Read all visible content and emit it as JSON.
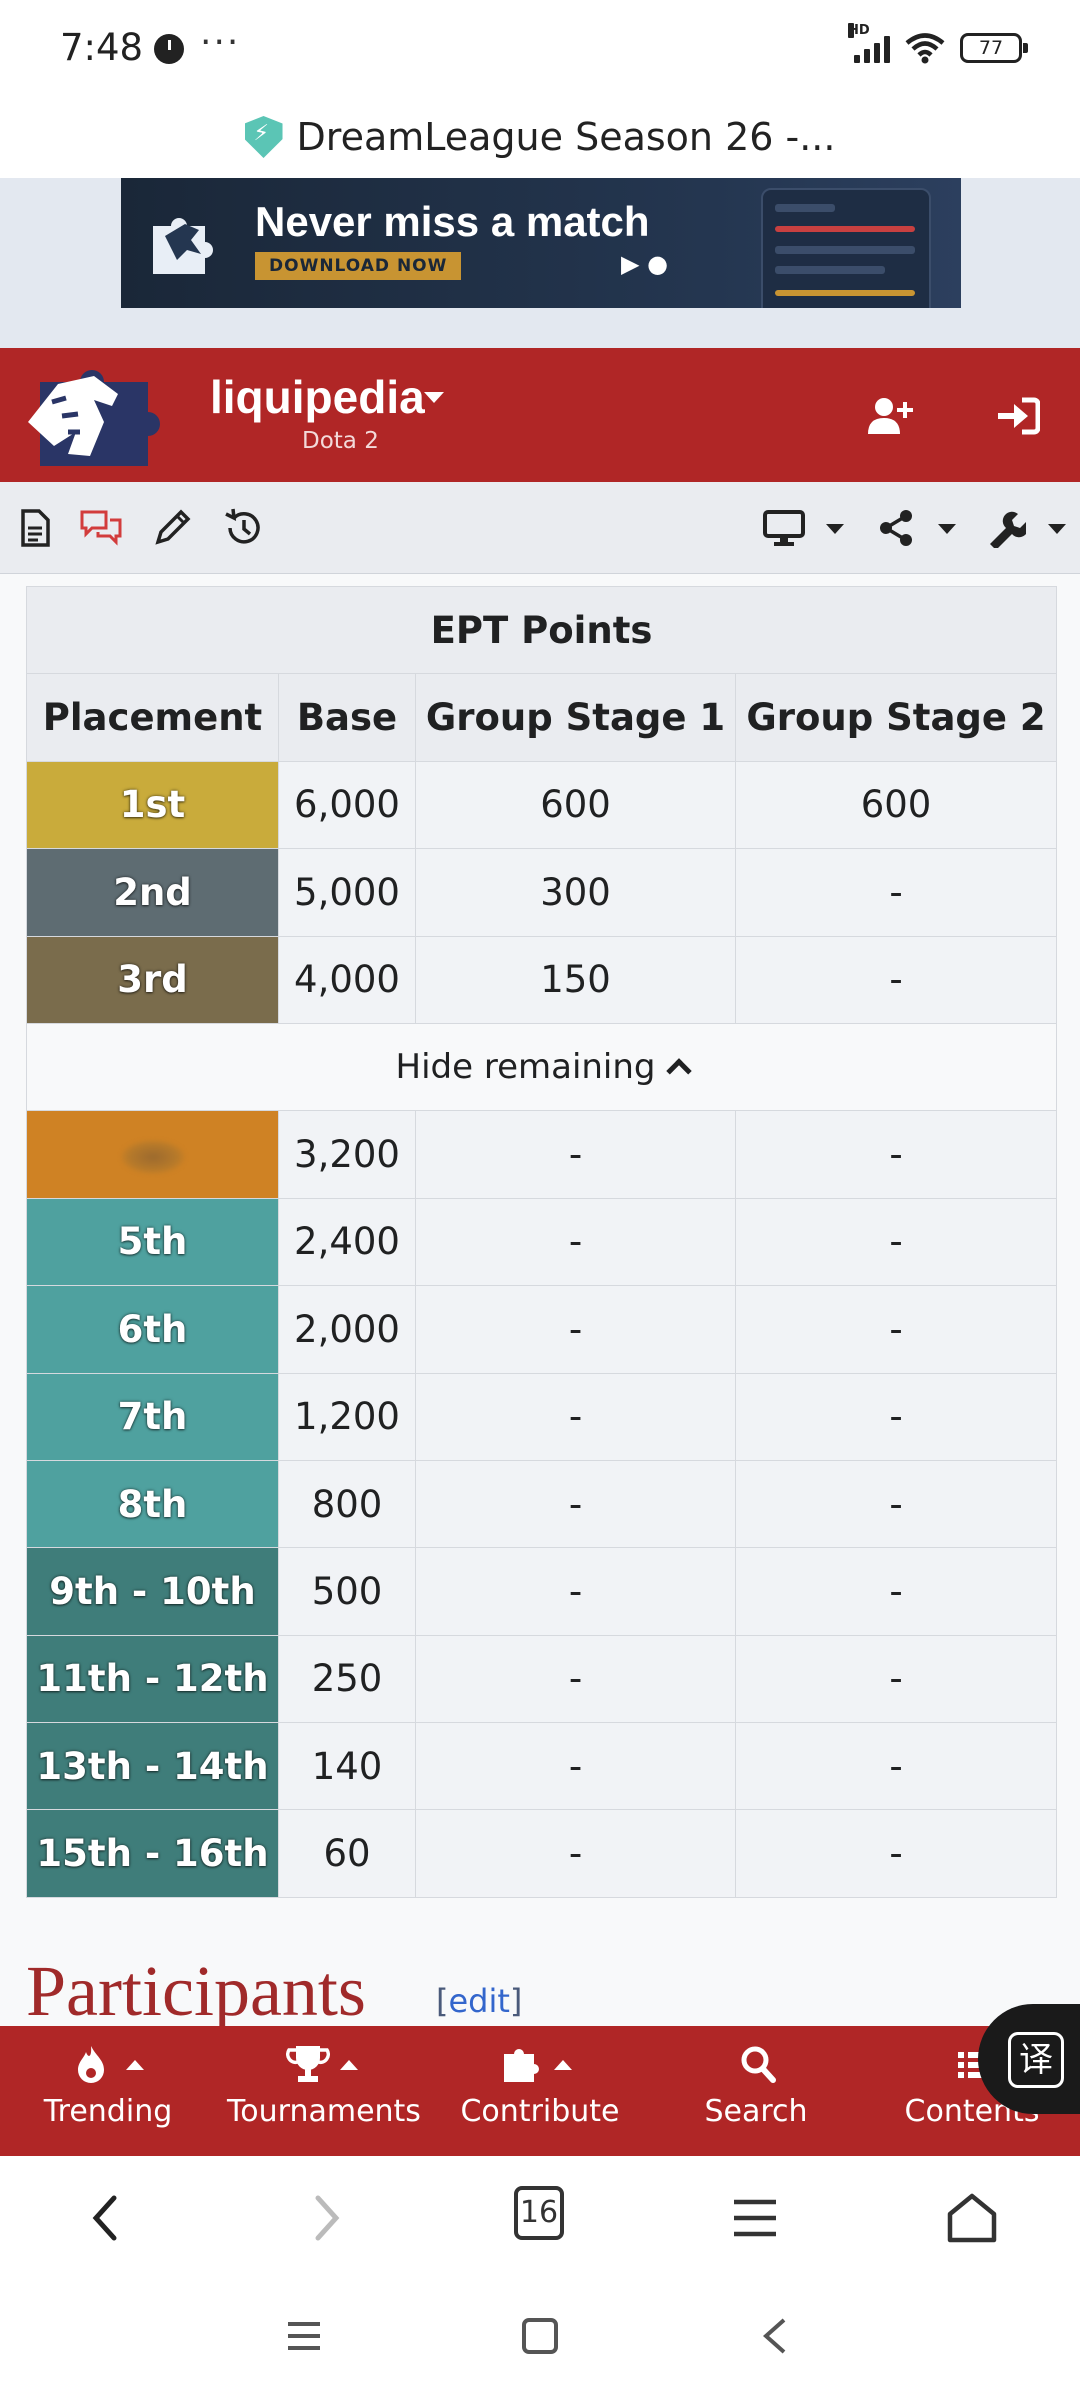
{
  "status_bar": {
    "time": "7:48",
    "more": "···",
    "network": "HD",
    "battery": "77"
  },
  "browser": {
    "page_title": "DreamLeague Season 26 -..."
  },
  "ad": {
    "headline": "Never miss a match",
    "cta": "DOWNLOAD NOW"
  },
  "site": {
    "name": "liquipedia",
    "wiki": "Dota 2"
  },
  "table": {
    "title": "EPT Points",
    "columns": [
      "Placement",
      "Base",
      "Group Stage 1",
      "Group Stage 2"
    ],
    "toggle_label": "Hide remaining",
    "rows": [
      {
        "placement": "1st",
        "base": "6,000",
        "gs1": "600",
        "gs2": "600",
        "color": "#c9ab3b"
      },
      {
        "placement": "2nd",
        "base": "5,000",
        "gs1": "300",
        "gs2": "-",
        "color": "#5e6c72"
      },
      {
        "placement": "3rd",
        "base": "4,000",
        "gs1": "150",
        "gs2": "-",
        "color": "#7a6c4c"
      },
      {
        "placement": "",
        "base": "3,200",
        "gs1": "-",
        "gs2": "-",
        "color": "#cf8224"
      },
      {
        "placement": "5th",
        "base": "2,400",
        "gs1": "-",
        "gs2": "-",
        "color": "#4fa19f"
      },
      {
        "placement": "6th",
        "base": "2,000",
        "gs1": "-",
        "gs2": "-",
        "color": "#4fa19f"
      },
      {
        "placement": "7th",
        "base": "1,200",
        "gs1": "-",
        "gs2": "-",
        "color": "#4fa19f"
      },
      {
        "placement": "8th",
        "base": "800",
        "gs1": "-",
        "gs2": "-",
        "color": "#4fa19f"
      },
      {
        "placement": "9th - 10th",
        "base": "500",
        "gs1": "-",
        "gs2": "-",
        "color": "#3f7d7a"
      },
      {
        "placement": "11th - 12th",
        "base": "250",
        "gs1": "-",
        "gs2": "-",
        "color": "#3f7d7a"
      },
      {
        "placement": "13th - 14th",
        "base": "140",
        "gs1": "-",
        "gs2": "-",
        "color": "#3f7d7a"
      },
      {
        "placement": "15th - 16th",
        "base": "60",
        "gs1": "-",
        "gs2": "-",
        "color": "#3f7d7a"
      }
    ]
  },
  "section": {
    "heading": "Participants",
    "edit_open": "[",
    "edit": "edit",
    "edit_close": "]"
  },
  "bottom_nav": [
    {
      "label": "Trending",
      "icon": "flame-icon"
    },
    {
      "label": "Tournaments",
      "icon": "trophy-icon"
    },
    {
      "label": "Contribute",
      "icon": "puzzle-icon"
    },
    {
      "label": "Search",
      "icon": "search-icon"
    },
    {
      "label": "Contents",
      "icon": "list-icon"
    }
  ],
  "translate": {
    "glyph": "译"
  },
  "browser_nav": {
    "tabs_count": "16"
  },
  "colors": {
    "brand_red": "#b02626",
    "toolbar": "#eaecf0"
  }
}
